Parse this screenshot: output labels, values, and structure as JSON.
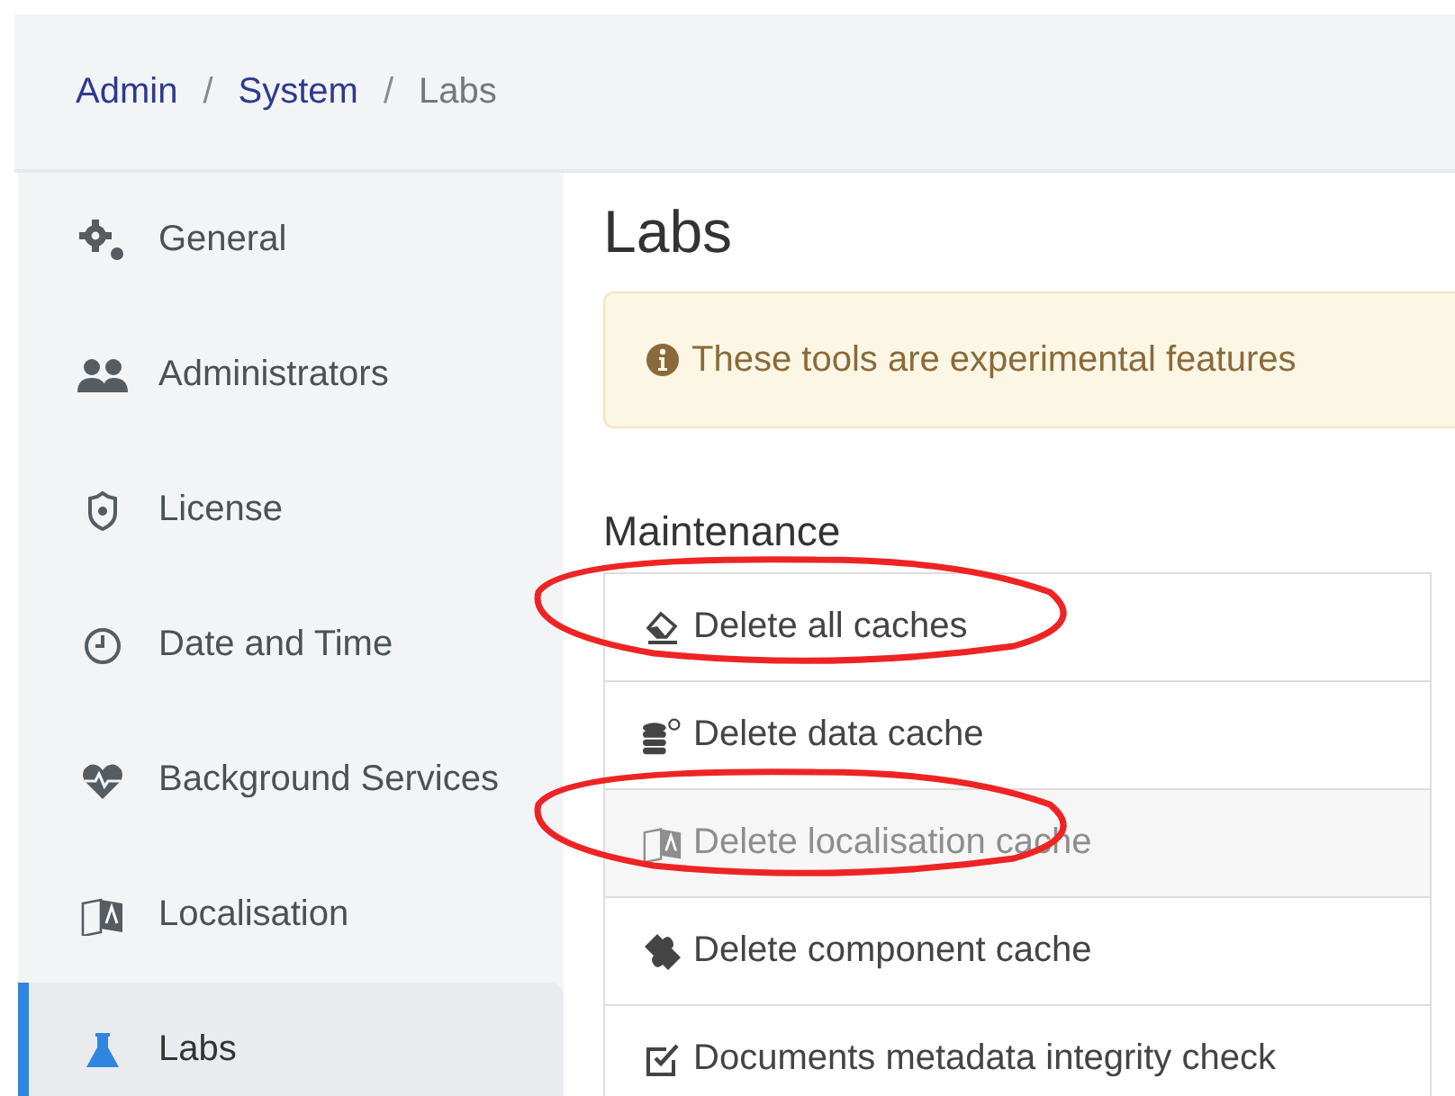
{
  "breadcrumb": {
    "separator": "/",
    "items": [
      {
        "label": "Admin",
        "current": false
      },
      {
        "label": "System",
        "current": false
      },
      {
        "label": "Labs",
        "current": true
      }
    ]
  },
  "sidebar": {
    "items": [
      {
        "label": "General",
        "selected": false
      },
      {
        "label": "Administrators",
        "selected": false
      },
      {
        "label": "License",
        "selected": false
      },
      {
        "label": "Date and Time",
        "selected": false
      },
      {
        "label": "Background Services",
        "selected": false
      },
      {
        "label": "Localisation",
        "selected": false
      },
      {
        "label": "Labs",
        "selected": true
      }
    ]
  },
  "page_title": "Labs",
  "alert": {
    "text": "These tools are experimental features"
  },
  "maintenance": {
    "heading": "Maintenance",
    "actions": [
      {
        "label": "Delete all caches",
        "disabled": false,
        "circled": true
      },
      {
        "label": "Delete data cache",
        "disabled": false,
        "circled": false
      },
      {
        "label": "Delete localisation cache",
        "disabled": true,
        "circled": true
      },
      {
        "label": "Delete component cache",
        "disabled": false,
        "circled": false
      },
      {
        "label": "Documents metadata integrity check",
        "disabled": false,
        "circled": false
      }
    ]
  }
}
